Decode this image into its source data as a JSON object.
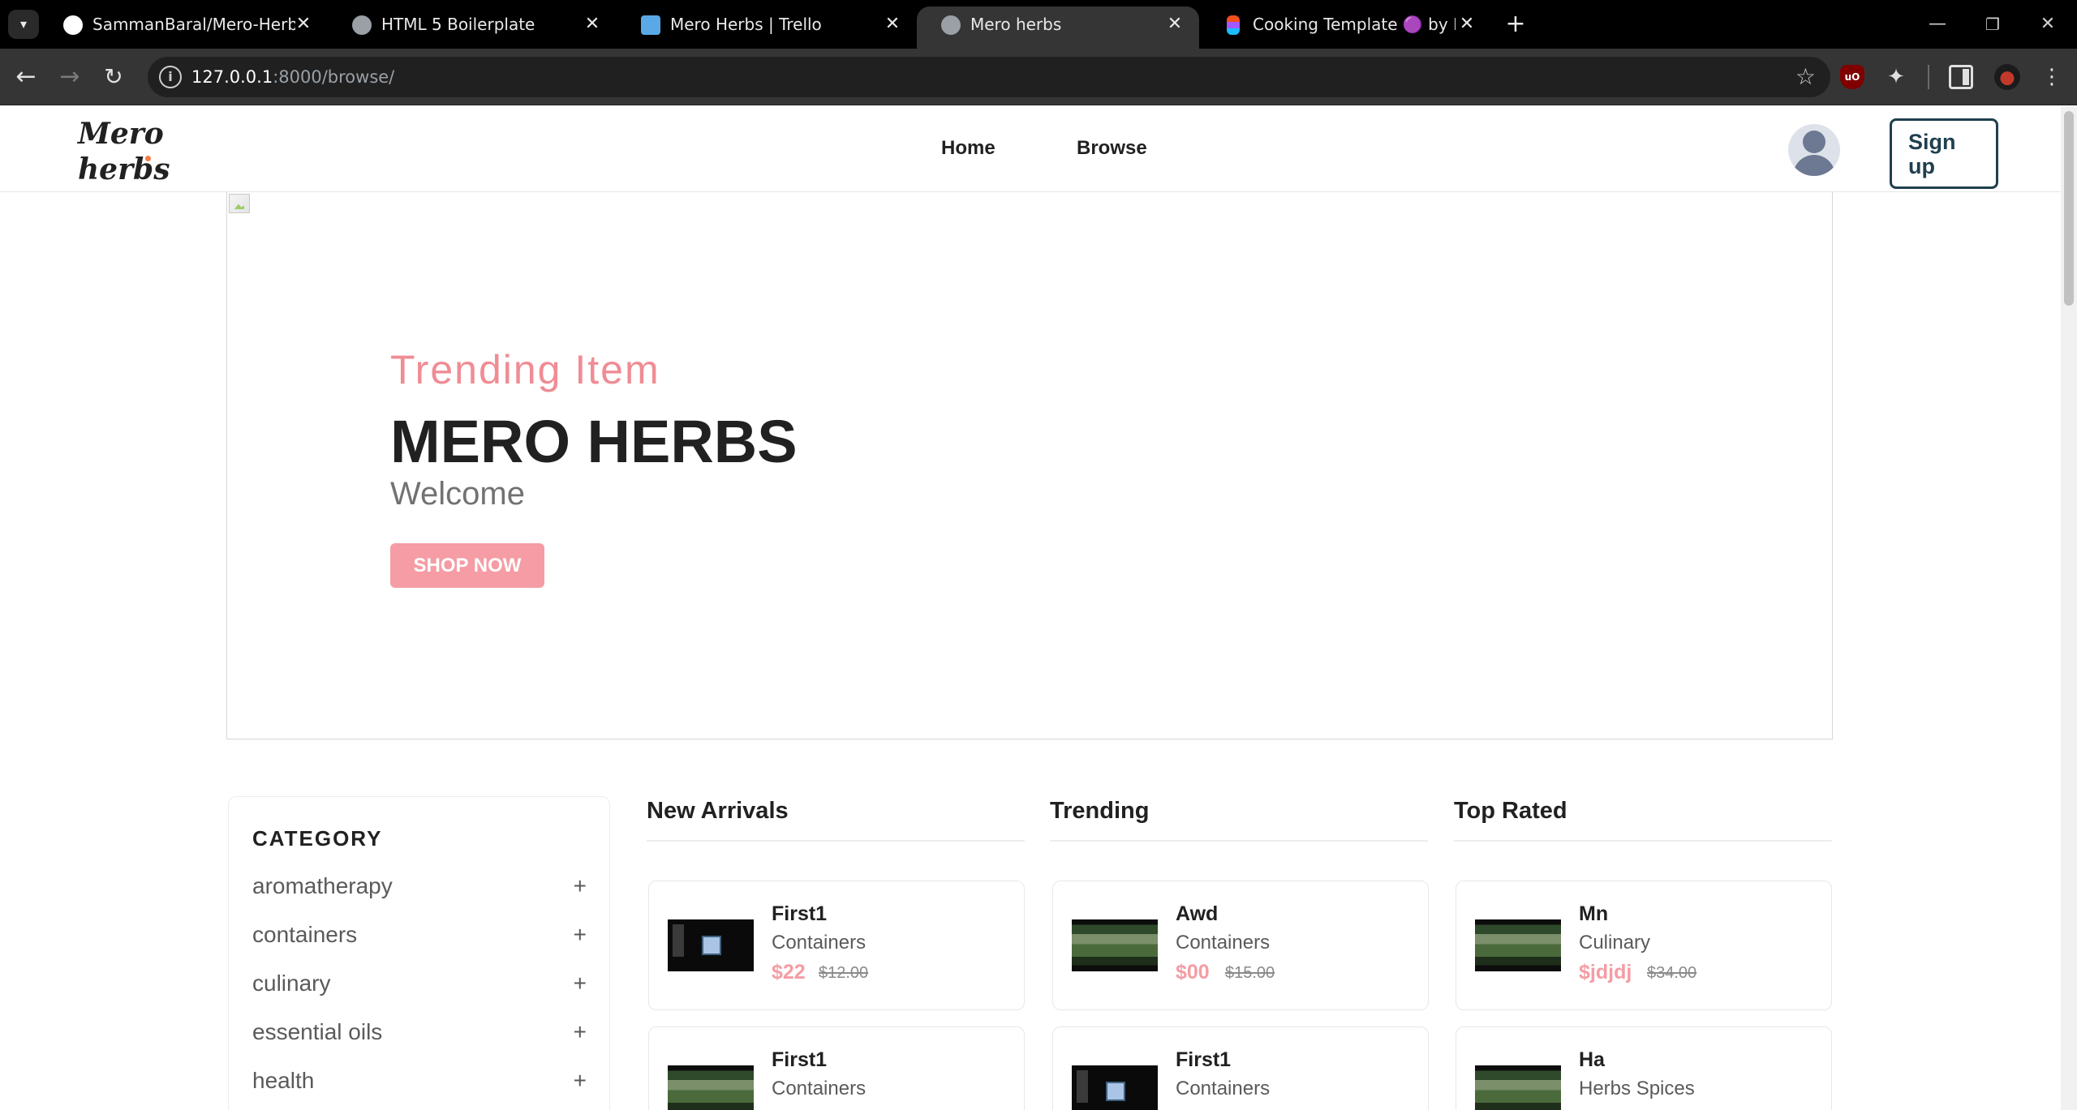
{
  "browser": {
    "tabs": [
      {
        "title": "SammanBaral/Mero-Herbs",
        "icon": "github-icon",
        "active": false
      },
      {
        "title": "HTML 5 Boilerplate",
        "icon": "globe-icon",
        "active": false
      },
      {
        "title": "Mero Herbs | Trello",
        "icon": "trello-icon",
        "active": false
      },
      {
        "title": "Mero herbs",
        "icon": "globe-icon",
        "active": true
      },
      {
        "title": "Cooking Template 🟣 by Flowb",
        "icon": "figma-icon",
        "active": false
      }
    ],
    "url_host": "127.0.0.1",
    "url_rest": ":8000/browse/"
  },
  "header": {
    "logo_line1": "Mero",
    "logo_line2": "herbs",
    "nav": {
      "home": "Home",
      "browse": "Browse"
    },
    "signup": "Sign up"
  },
  "banner": {
    "subtitle": "Trending Item",
    "title": "MERO HERBS",
    "text": "Welcome",
    "button": "SHOP NOW"
  },
  "categories": {
    "title": "CATEGORY",
    "items": [
      "aromatherapy",
      "containers",
      "culinary",
      "essential oils",
      "health"
    ]
  },
  "columns": [
    {
      "title": "New Arrivals",
      "products": [
        {
          "name": "First1",
          "category": "Containers",
          "price": "$22",
          "old_price": "$12.00",
          "thumb": "dark"
        },
        {
          "name": "First1",
          "category": "Containers",
          "price": "",
          "old_price": "",
          "thumb": "green"
        }
      ]
    },
    {
      "title": "Trending",
      "products": [
        {
          "name": "Awd",
          "category": "Containers",
          "price": "$00",
          "old_price": "$15.00",
          "thumb": "green"
        },
        {
          "name": "First1",
          "category": "Containers",
          "price": "",
          "old_price": "",
          "thumb": "dark"
        }
      ]
    },
    {
      "title": "Top Rated",
      "products": [
        {
          "name": "Mn",
          "category": "Culinary",
          "price": "$jdjdj",
          "old_price": "$34.00",
          "thumb": "green"
        },
        {
          "name": "Ha",
          "category": "Herbs Spices",
          "price": "",
          "old_price": "",
          "thumb": "green"
        }
      ]
    }
  ],
  "colors": {
    "accent": "#f59ca4",
    "dark": "#212121",
    "signup_border": "#1f3f4f"
  }
}
